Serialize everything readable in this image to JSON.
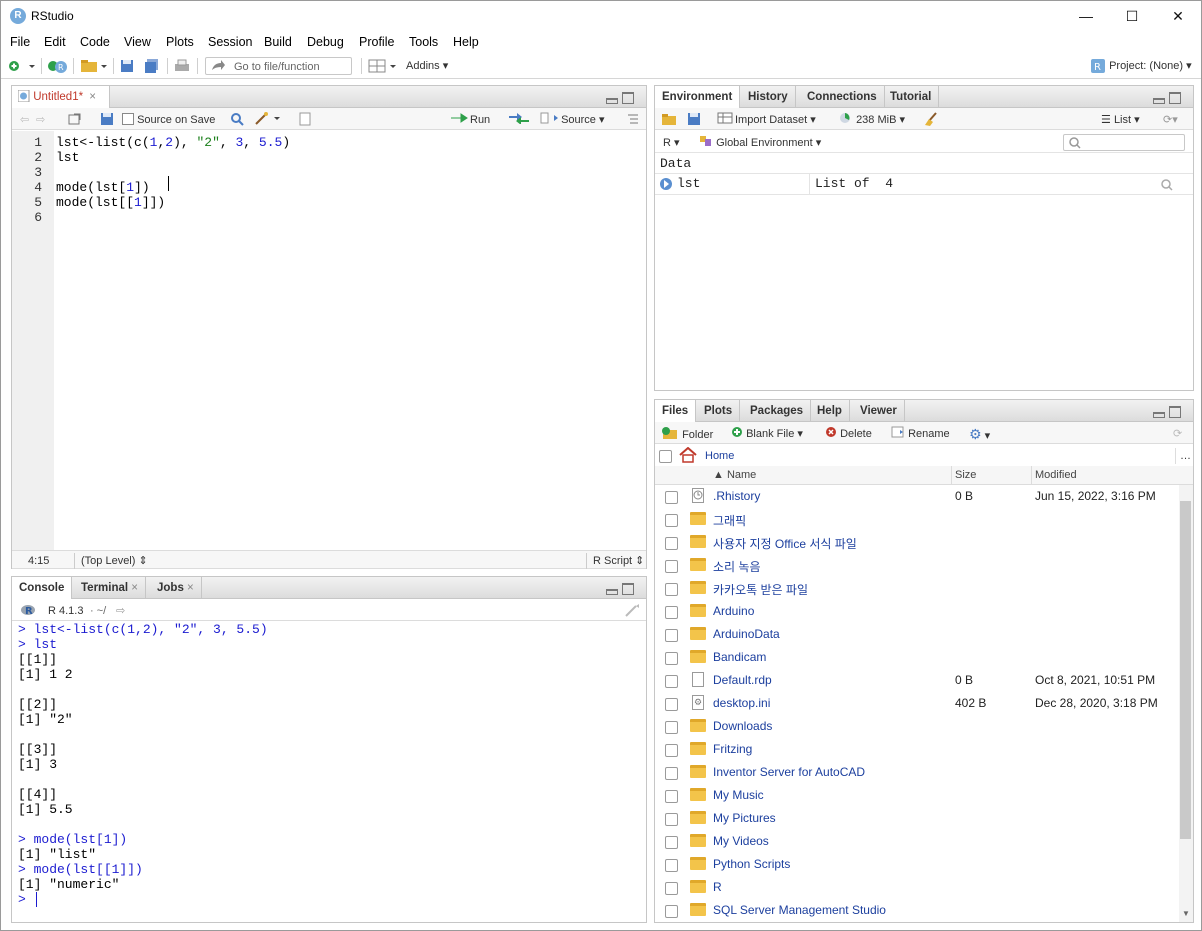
{
  "window": {
    "title": "RStudio",
    "minimize": "—",
    "maximize": "☐",
    "close": "✕"
  },
  "menu": [
    "File",
    "Edit",
    "Code",
    "View",
    "Plots",
    "Session",
    "Build",
    "Debug",
    "Profile",
    "Tools",
    "Help"
  ],
  "toolbar": {
    "goto_placeholder": "Go to file/function",
    "addins": "Addins",
    "project": "Project: (None)"
  },
  "editor": {
    "tab": "Untitled1*",
    "source_on_save": "Source on Save",
    "run": "Run",
    "source": "Source",
    "lines": [
      {
        "n": "1",
        "tokens": [
          [
            "lst<-list(c(",
            ""
          ],
          [
            "1",
            "num"
          ],
          [
            ",",
            ""
          ],
          [
            "2",
            "num"
          ],
          [
            "), ",
            ""
          ],
          [
            "\"2\"",
            "str"
          ],
          [
            ", ",
            ""
          ],
          [
            "3",
            "num"
          ],
          [
            ", ",
            ""
          ],
          [
            "5.5",
            "num"
          ],
          [
            ")",
            ""
          ]
        ]
      },
      {
        "n": "2",
        "tokens": [
          [
            "lst",
            ""
          ]
        ]
      },
      {
        "n": "3",
        "tokens": []
      },
      {
        "n": "4",
        "tokens": [
          [
            "mode(lst[",
            ""
          ],
          [
            "1",
            "num"
          ],
          [
            "])",
            ""
          ]
        ]
      },
      {
        "n": "5",
        "tokens": [
          [
            "mode(lst[[",
            ""
          ],
          [
            "1",
            "num"
          ],
          [
            "]])",
            ""
          ]
        ]
      },
      {
        "n": "6",
        "tokens": []
      }
    ],
    "status_pos": "4:15",
    "status_scope": "(Top Level) ⇕",
    "status_type": "R Script ⇕"
  },
  "console": {
    "tabs": [
      "Console",
      "Terminal",
      "Jobs"
    ],
    "version": "R 4.1.3",
    "path": "· ~/",
    "lines": [
      {
        "t": "> lst<-list(c(1,2), \"2\", 3, 5.5)",
        "in": true
      },
      {
        "t": "> lst",
        "in": true
      },
      {
        "t": "[[1]]",
        "in": false
      },
      {
        "t": "[1] 1 2",
        "in": false
      },
      {
        "t": "",
        "in": false
      },
      {
        "t": "[[2]]",
        "in": false
      },
      {
        "t": "[1] \"2\"",
        "in": false
      },
      {
        "t": "",
        "in": false
      },
      {
        "t": "[[3]]",
        "in": false
      },
      {
        "t": "[1] 3",
        "in": false
      },
      {
        "t": "",
        "in": false
      },
      {
        "t": "[[4]]",
        "in": false
      },
      {
        "t": "[1] 5.5",
        "in": false
      },
      {
        "t": "",
        "in": false
      },
      {
        "t": "> mode(lst[1])",
        "in": true
      },
      {
        "t": "[1] \"list\"",
        "in": false
      },
      {
        "t": "> mode(lst[[1]])",
        "in": true
      },
      {
        "t": "[1] \"numeric\"",
        "in": false
      },
      {
        "t": "> ",
        "in": true
      }
    ]
  },
  "environment": {
    "tabs": [
      "Environment",
      "History",
      "Connections",
      "Tutorial"
    ],
    "import": "Import Dataset",
    "memory": "238 MiB",
    "view": "List",
    "lang": "R",
    "scope": "Global Environment",
    "section": "Data",
    "rows": [
      {
        "name": "lst",
        "value": "List of  4"
      }
    ]
  },
  "files": {
    "tabs": [
      "Files",
      "Plots",
      "Packages",
      "Help",
      "Viewer"
    ],
    "actions": {
      "folder": "Folder",
      "blank": "Blank File",
      "delete": "Delete",
      "rename": "Rename"
    },
    "breadcrumb": "Home",
    "more": "…",
    "columns": {
      "name": "▲ Name",
      "size": "Size",
      "modified": "Modified"
    },
    "rows": [
      {
        "name": ".Rhistory",
        "size": "0 B",
        "modified": "Jun 15, 2022, 3:16 PM",
        "kind": "history"
      },
      {
        "name": "그래픽",
        "size": "",
        "modified": "",
        "kind": "folder"
      },
      {
        "name": "사용자 지정 Office 서식 파일",
        "size": "",
        "modified": "",
        "kind": "folder"
      },
      {
        "name": "소리 녹음",
        "size": "",
        "modified": "",
        "kind": "folder"
      },
      {
        "name": "카카오톡 받은 파일",
        "size": "",
        "modified": "",
        "kind": "folder"
      },
      {
        "name": "Arduino",
        "size": "",
        "modified": "",
        "kind": "folder"
      },
      {
        "name": "ArduinoData",
        "size": "",
        "modified": "",
        "kind": "folder"
      },
      {
        "name": "Bandicam",
        "size": "",
        "modified": "",
        "kind": "folder"
      },
      {
        "name": "Default.rdp",
        "size": "0 B",
        "modified": "Oct 8, 2021, 10:51 PM",
        "kind": "file"
      },
      {
        "name": "desktop.ini",
        "size": "402 B",
        "modified": "Dec 28, 2020, 3:18 PM",
        "kind": "settings"
      },
      {
        "name": "Downloads",
        "size": "",
        "modified": "",
        "kind": "folder"
      },
      {
        "name": "Fritzing",
        "size": "",
        "modified": "",
        "kind": "folder"
      },
      {
        "name": "Inventor Server for AutoCAD",
        "size": "",
        "modified": "",
        "kind": "folder"
      },
      {
        "name": "My Music",
        "size": "",
        "modified": "",
        "kind": "folder"
      },
      {
        "name": "My Pictures",
        "size": "",
        "modified": "",
        "kind": "folder"
      },
      {
        "name": "My Videos",
        "size": "",
        "modified": "",
        "kind": "folder"
      },
      {
        "name": "Python Scripts",
        "size": "",
        "modified": "",
        "kind": "folder"
      },
      {
        "name": "R",
        "size": "",
        "modified": "",
        "kind": "folder"
      },
      {
        "name": "SQL Server Management Studio",
        "size": "",
        "modified": "",
        "kind": "folder"
      }
    ]
  }
}
